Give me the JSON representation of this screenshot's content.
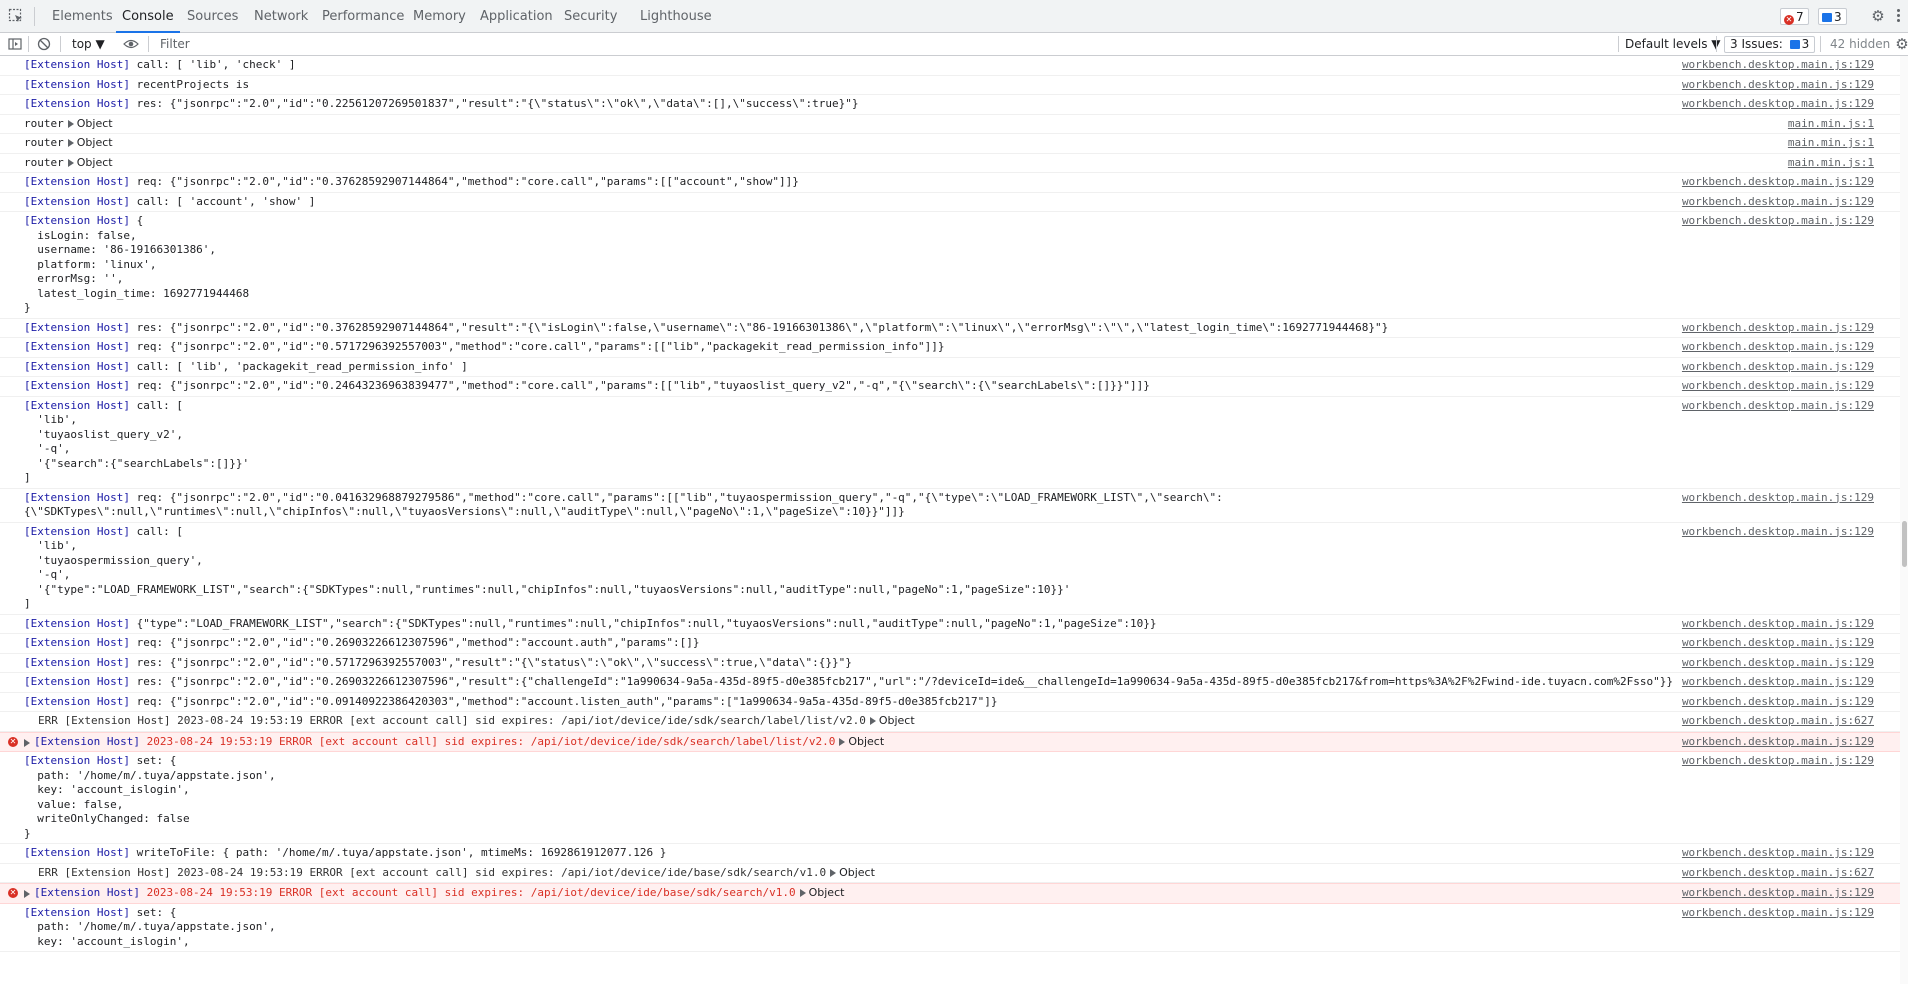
{
  "tabs": [
    "Elements",
    "Console",
    "Sources",
    "Network",
    "Performance",
    "Memory",
    "Application",
    "Security",
    "Lighthouse"
  ],
  "active_tab": "Console",
  "badges": {
    "errors": "7",
    "messages": "3"
  },
  "toolbar": {
    "context": "top ▼",
    "filter_placeholder": "Filter",
    "levels": "Default levels ▼",
    "issues_label": "3 Issues:",
    "issues_count": "3",
    "hidden": "42 hidden"
  },
  "rows": [
    {
      "kind": "log",
      "lines": [
        "[Extension Host] call: [ 'lib', 'check' ]"
      ],
      "src": "workbench.desktop.main.js:129"
    },
    {
      "kind": "log",
      "lines": [
        "[Extension Host] recentProjects is"
      ],
      "src": "workbench.desktop.main.js:129"
    },
    {
      "kind": "log",
      "lines": [
        "[Extension Host] res: {\"jsonrpc\":\"2.0\",\"id\":\"0.22561207269501837\",\"result\":\"{\\\"status\\\":\\\"ok\\\",\\\"data\\\":[],\\\"success\\\":true}\"}"
      ],
      "src": "workbench.desktop.main.js:129"
    },
    {
      "kind": "obj",
      "prefix": "router",
      "obj": "Object",
      "src": "main.min.js:1"
    },
    {
      "kind": "obj",
      "prefix": "router",
      "obj": "Object",
      "src": "main.min.js:1"
    },
    {
      "kind": "obj",
      "prefix": "router",
      "obj": "Object",
      "src": "main.min.js:1"
    },
    {
      "kind": "log",
      "lines": [
        "[Extension Host] req: {\"jsonrpc\":\"2.0\",\"id\":\"0.37628592907144864\",\"method\":\"core.call\",\"params\":[[\"account\",\"show\"]]}"
      ],
      "src": "workbench.desktop.main.js:129"
    },
    {
      "kind": "log",
      "lines": [
        "[Extension Host] call: [ 'account', 'show' ]"
      ],
      "src": "workbench.desktop.main.js:129"
    },
    {
      "kind": "log",
      "lines": [
        "[Extension Host] {",
        "  isLogin: false,",
        "  username: '86-19166301386',",
        "  platform: 'linux',",
        "  errorMsg: '',",
        "  latest_login_time: 1692771944468",
        "}"
      ],
      "src": "workbench.desktop.main.js:129"
    },
    {
      "kind": "log",
      "lines": [
        "[Extension Host] res: {\"jsonrpc\":\"2.0\",\"id\":\"0.37628592907144864\",\"result\":\"{\\\"isLogin\\\":false,\\\"username\\\":\\\"86-19166301386\\\",\\\"platform\\\":\\\"linux\\\",\\\"errorMsg\\\":\\\"\\\",\\\"latest_login_time\\\":1692771944468}\"}"
      ],
      "src": "workbench.desktop.main.js:129"
    },
    {
      "kind": "log",
      "lines": [
        "[Extension Host] req: {\"jsonrpc\":\"2.0\",\"id\":\"0.5717296392557003\",\"method\":\"core.call\",\"params\":[[\"lib\",\"packagekit_read_permission_info\"]]}"
      ],
      "src": "workbench.desktop.main.js:129"
    },
    {
      "kind": "log",
      "lines": [
        "[Extension Host] call: [ 'lib', 'packagekit_read_permission_info' ]"
      ],
      "src": "workbench.desktop.main.js:129"
    },
    {
      "kind": "log",
      "lines": [
        "[Extension Host] req: {\"jsonrpc\":\"2.0\",\"id\":\"0.24643236963839477\",\"method\":\"core.call\",\"params\":[[\"lib\",\"tuyaoslist_query_v2\",\"-q\",\"{\\\"search\\\":{\\\"searchLabels\\\":[]}}\"]]}"
      ],
      "src": "workbench.desktop.main.js:129"
    },
    {
      "kind": "log",
      "lines": [
        "[Extension Host] call: [",
        "  'lib',",
        "  'tuyaoslist_query_v2',",
        "  '-q',",
        "  '{\"search\":{\"searchLabels\":[]}}'",
        "]"
      ],
      "src": "workbench.desktop.main.js:129"
    },
    {
      "kind": "log",
      "lines": [
        "[Extension Host] req: {\"jsonrpc\":\"2.0\",\"id\":\"0.041632968879279586\",\"method\":\"core.call\",\"params\":[[\"lib\",\"tuyaospermission_query\",\"-q\",\"{\\\"type\\\":\\\"LOAD_FRAMEWORK_LIST\\\",\\\"search\\\":",
        "{\\\"SDKTypes\\\":null,\\\"runtimes\\\":null,\\\"chipInfos\\\":null,\\\"tuyaosVersions\\\":null,\\\"auditType\\\":null,\\\"pageNo\\\":1,\\\"pageSize\\\":10}}\"]]}"
      ],
      "src": "workbench.desktop.main.js:129"
    },
    {
      "kind": "log",
      "lines": [
        "[Extension Host] call: [",
        "  'lib',",
        "  'tuyaospermission_query',",
        "  '-q',",
        "  '{\"type\":\"LOAD_FRAMEWORK_LIST\",\"search\":{\"SDKTypes\":null,\"runtimes\":null,\"chipInfos\":null,\"tuyaosVersions\":null,\"auditType\":null,\"pageNo\":1,\"pageSize\":10}}'",
        "]"
      ],
      "src": "workbench.desktop.main.js:129"
    },
    {
      "kind": "log",
      "lines": [
        "[Extension Host] {\"type\":\"LOAD_FRAMEWORK_LIST\",\"search\":{\"SDKTypes\":null,\"runtimes\":null,\"chipInfos\":null,\"tuyaosVersions\":null,\"auditType\":null,\"pageNo\":1,\"pageSize\":10}}"
      ],
      "src": "workbench.desktop.main.js:129"
    },
    {
      "kind": "log",
      "lines": [
        "[Extension Host] req: {\"jsonrpc\":\"2.0\",\"id\":\"0.26903226612307596\",\"method\":\"account.auth\",\"params\":[]}"
      ],
      "src": "workbench.desktop.main.js:129"
    },
    {
      "kind": "log",
      "lines": [
        "[Extension Host] res: {\"jsonrpc\":\"2.0\",\"id\":\"0.5717296392557003\",\"result\":\"{\\\"status\\\":\\\"ok\\\",\\\"success\\\":true,\\\"data\\\":{}}\"}"
      ],
      "src": "workbench.desktop.main.js:129"
    },
    {
      "kind": "log",
      "lines": [
        "[Extension Host] res: {\"jsonrpc\":\"2.0\",\"id\":\"0.26903226612307596\",\"result\":{\"challengeId\":\"1a990634-9a5a-435d-89f5-d0e385fcb217\",\"url\":\"/?deviceId=ide&__challengeId=1a990634-9a5a-435d-89f5-d0e385fcb217&from=https%3A%2F%2Fwind-ide.tuyacn.com%2Fsso\"}}"
      ],
      "src": "workbench.desktop.main.js:129"
    },
    {
      "kind": "log",
      "lines": [
        "[Extension Host] req: {\"jsonrpc\":\"2.0\",\"id\":\"0.09140922386420303\",\"method\":\"account.listen_auth\",\"params\":[\"1a990634-9a5a-435d-89f5-d0e385fcb217\"]}"
      ],
      "src": "workbench.desktop.main.js:129"
    },
    {
      "kind": "errtext",
      "text": "ERR [Extension Host] 2023-08-24 19:53:19 ERROR [ext account call] sid expires: /api/iot/device/ide/sdk/search/label/list/v2.0",
      "obj": "Object",
      "src": "workbench.desktop.main.js:627"
    },
    {
      "kind": "error",
      "text": "[Extension Host] 2023-08-24 19:53:19 ERROR [ext account call] sid expires: /api/iot/device/ide/sdk/search/label/list/v2.0",
      "obj": "Object",
      "src": "workbench.desktop.main.js:129"
    },
    {
      "kind": "log",
      "lines": [
        "[Extension Host] set: {",
        "  path: '/home/m/.tuya/appstate.json',",
        "  key: 'account_islogin',",
        "  value: false,",
        "  writeOnlyChanged: false",
        "}"
      ],
      "src": "workbench.desktop.main.js:129"
    },
    {
      "kind": "log",
      "lines": [
        "[Extension Host] writeToFile: { path: '/home/m/.tuya/appstate.json', mtimeMs: 1692861912077.126 }"
      ],
      "src": "workbench.desktop.main.js:129"
    },
    {
      "kind": "errtext",
      "text": "ERR [Extension Host] 2023-08-24 19:53:19 ERROR [ext account call] sid expires: /api/iot/device/ide/base/sdk/search/v1.0",
      "obj": "Object",
      "src": "workbench.desktop.main.js:627"
    },
    {
      "kind": "error",
      "text": "[Extension Host] 2023-08-24 19:53:19 ERROR [ext account call] sid expires: /api/iot/device/ide/base/sdk/search/v1.0",
      "obj": "Object",
      "src": "workbench.desktop.main.js:129"
    },
    {
      "kind": "log",
      "lines": [
        "[Extension Host] set: {",
        "  path: '/home/m/.tuya/appstate.json',",
        "  key: 'account_islogin',"
      ],
      "src": "workbench.desktop.main.js:129"
    }
  ]
}
